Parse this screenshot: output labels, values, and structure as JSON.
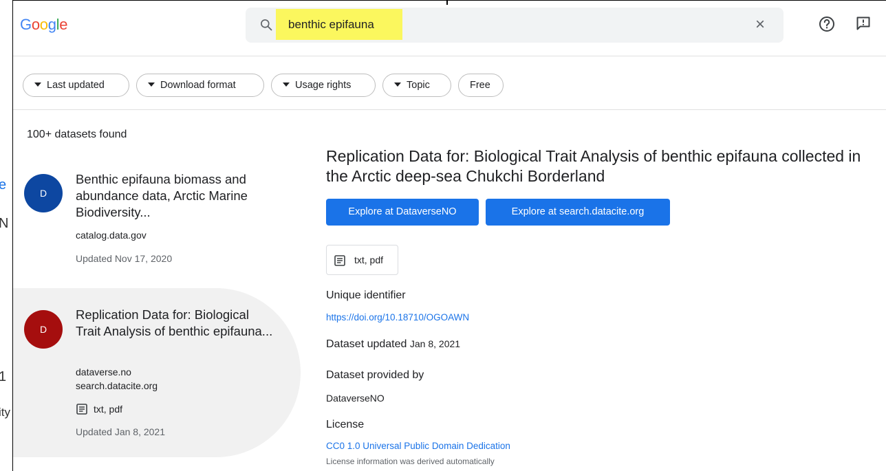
{
  "background_window": {
    "fragments": [
      "e",
      "N",
      "1",
      "ity"
    ]
  },
  "header": {
    "logo": [
      "G",
      "o",
      "o",
      "g",
      "l",
      "e"
    ],
    "search_query": "benthic epifauna",
    "clear_icon": "close-icon",
    "help_icon": "help-circle-icon",
    "feedback_icon": "feedback-icon"
  },
  "filters": {
    "chips": [
      {
        "label": "Last updated",
        "dropdown": true
      },
      {
        "label": "Download format",
        "dropdown": true
      },
      {
        "label": "Usage rights",
        "dropdown": true
      },
      {
        "label": "Topic",
        "dropdown": true
      },
      {
        "label": "Free",
        "dropdown": false
      }
    ]
  },
  "results": {
    "count": "100+ datasets found",
    "items": [
      {
        "avatar": "D",
        "avatar_color": "#0d47a1",
        "title": "Benthic epifauna biomass and abundance data, Arctic Marine Biodiversity...",
        "sources": [
          "catalog.data.gov"
        ],
        "format": "",
        "updated": "Updated Nov 17, 2020"
      },
      {
        "avatar": "D",
        "avatar_color": "#a50e0e",
        "title": "Replication Data for: Biological Trait Analysis of benthic epifauna...",
        "sources": [
          "dataverse.no",
          "search.datacite.org"
        ],
        "format": "txt, pdf",
        "updated": "Updated Jan 8, 2021"
      }
    ]
  },
  "detail": {
    "title": "Replication Data for: Biological Trait Analysis of benthic epifauna collected in the Arctic deep-sea Chukchi Borderland",
    "buttons": [
      "Explore at DataverseNO",
      "Explore at search.datacite.org"
    ],
    "format": "txt, pdf",
    "unique_identifier_label": "Unique identifier",
    "unique_identifier": "https://doi.org/10.18710/OGOAWN",
    "updated_label": "Dataset updated",
    "updated_value": "Jan 8, 2021",
    "provided_by_label": "Dataset provided by",
    "provided_by": "DataverseNO",
    "license_label": "License",
    "license": "CC0 1.0 Universal Public Domain Dedication",
    "license_note": "License information was derived automatically"
  },
  "colors": {
    "accent": "#1a73e8",
    "highlight": "#fbf75e",
    "search_bg": "#f1f3f4"
  }
}
